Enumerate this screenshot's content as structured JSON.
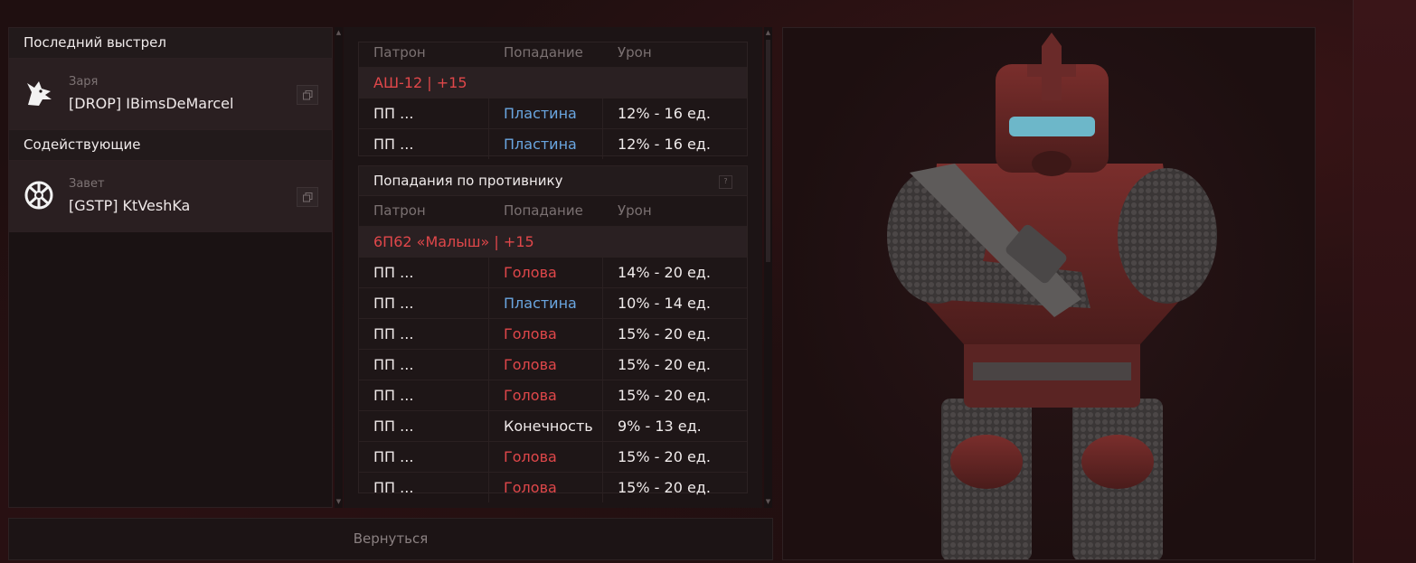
{
  "last_shot": {
    "header": "Последний выстрел",
    "clan": "Заря",
    "player": "[DROP] IBimsDeMarcel"
  },
  "assists": {
    "header": "Содействующие",
    "clan": "Завет",
    "player": "[GSTP] KtVeshKa"
  },
  "table1": {
    "columns": [
      "Патрон",
      "Попадание",
      "Урон"
    ],
    "weapon": "АШ-12 | +15",
    "rows": [
      {
        "ammo": "ПП ...",
        "hit": "Пластина",
        "damage": "12% - 16 ед."
      },
      {
        "ammo": "ПП ...",
        "hit": "Пластина",
        "damage": "12% - 16 ед."
      }
    ]
  },
  "table2": {
    "title": "Попадания по противнику",
    "help": "?",
    "columns": [
      "Патрон",
      "Попадание",
      "Урон"
    ],
    "weapon": "6П62 «Малыш» | +15",
    "rows": [
      {
        "ammo": "ПП ...",
        "hit": "Голова",
        "damage": "14% - 20 ед."
      },
      {
        "ammo": "ПП ...",
        "hit": "Пластина",
        "damage": "10% - 14 ед."
      },
      {
        "ammo": "ПП ...",
        "hit": "Голова",
        "damage": "15% - 20 ед."
      },
      {
        "ammo": "ПП ...",
        "hit": "Голова",
        "damage": "15% - 20 ед."
      },
      {
        "ammo": "ПП ...",
        "hit": "Голова",
        "damage": "15% - 20 ед."
      },
      {
        "ammo": "ПП ...",
        "hit": "Конечность",
        "damage": "9% - 13 ед."
      },
      {
        "ammo": "ПП ...",
        "hit": "Голова",
        "damage": "15% - 20 ед."
      },
      {
        "ammo": "ПП ...",
        "hit": "Голова",
        "damage": "15% - 20 ед."
      }
    ]
  },
  "back_button": "Вернуться",
  "colors": {
    "head": "#e0474a",
    "plate": "#6aa6e0",
    "limb": "#efe9e9",
    "weapon": "#e0474a"
  }
}
